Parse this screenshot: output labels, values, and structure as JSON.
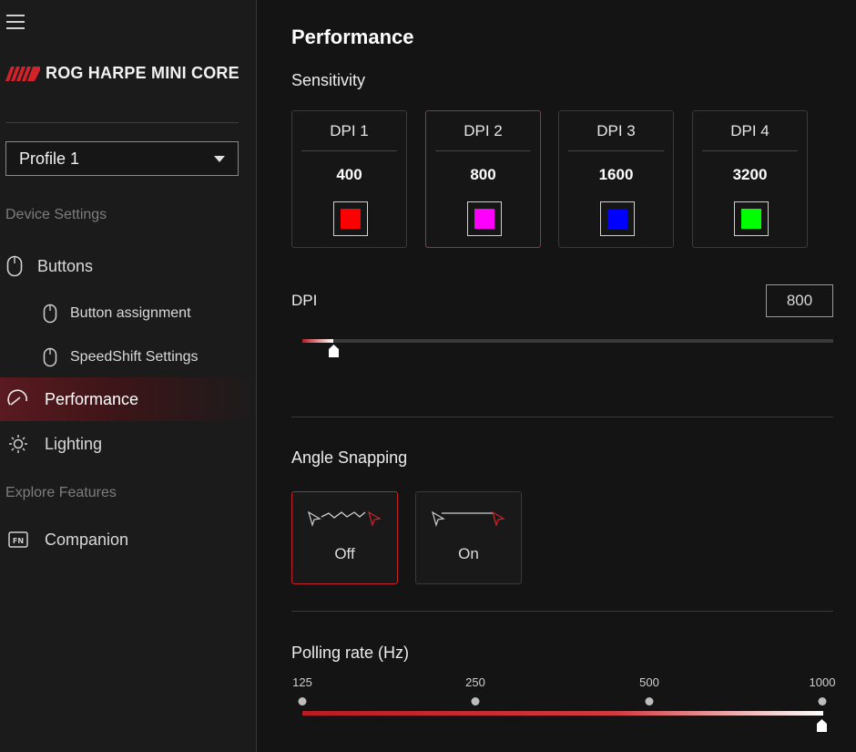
{
  "app": {
    "device_name": "ROG HARPE MINI CORE",
    "accent_color": "#c3222b"
  },
  "sidebar": {
    "profile": {
      "selected": "Profile 1"
    },
    "device_settings_label": "Device Settings",
    "explore_label": "Explore Features",
    "items": [
      {
        "label": "Buttons",
        "icon": "mouse-icon"
      },
      {
        "label": "Button assignment",
        "icon": "mouse-icon"
      },
      {
        "label": "SpeedShift Settings",
        "icon": "mouse-icon"
      },
      {
        "label": "Performance",
        "icon": "gauge-icon",
        "active": true
      },
      {
        "label": "Lighting",
        "icon": "sun-icon"
      },
      {
        "label": "Companion",
        "icon": "fn-key-icon"
      }
    ]
  },
  "main": {
    "title": "Performance",
    "sensitivity": {
      "label": "Sensitivity",
      "stages": [
        {
          "label": "DPI 1",
          "value": "400",
          "color": "#ff0000"
        },
        {
          "label": "DPI 2",
          "value": "800",
          "color": "#ff00ff",
          "active": true
        },
        {
          "label": "DPI 3",
          "value": "1600",
          "color": "#0000ff"
        },
        {
          "label": "DPI 4",
          "value": "3200",
          "color": "#00ff00"
        }
      ]
    },
    "dpi": {
      "label": "DPI",
      "value": "800",
      "slider_fraction": 0.059
    },
    "angle_snapping": {
      "label": "Angle Snapping",
      "options": [
        {
          "label": "Off",
          "active": true
        },
        {
          "label": "On",
          "active": false
        }
      ]
    },
    "polling_rate": {
      "label": "Polling rate (Hz)",
      "ticks": [
        "125",
        "250",
        "500",
        "1000"
      ],
      "selected": "1000"
    }
  }
}
